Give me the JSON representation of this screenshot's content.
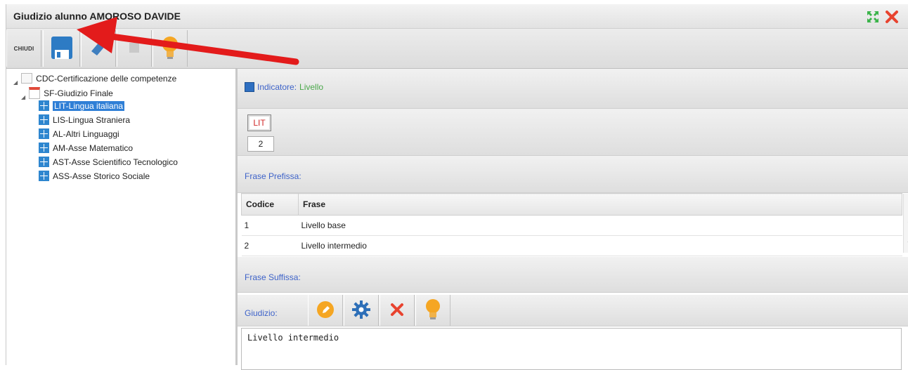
{
  "window": {
    "title": "Giudizio alunno AMOROSO DAVIDE"
  },
  "toolbar": {
    "close_label": "CHIUDI"
  },
  "tree": {
    "root": "CDC-Certificazione delle competenze",
    "child": "SF-Giudizio Finale",
    "items": [
      {
        "label": "LIT-Lingua italiana",
        "selected": true
      },
      {
        "label": "LIS-Lingua Straniera",
        "selected": false
      },
      {
        "label": "AL-Altri Linguaggi",
        "selected": false
      },
      {
        "label": "AM-Asse Matematico",
        "selected": false
      },
      {
        "label": "AST-Asse Scientifico Tecnologico",
        "selected": false
      },
      {
        "label": "ASS-Asse Storico Sociale",
        "selected": false
      }
    ]
  },
  "indicator": {
    "label": "Indicatore:",
    "value": "Livello"
  },
  "code": {
    "button": "LIT",
    "value": "2"
  },
  "prefix": {
    "label": "Frase Prefissa:"
  },
  "table": {
    "headers": [
      "Codice",
      "Frase"
    ],
    "rows": [
      [
        "1",
        "Livello base"
      ],
      [
        "2",
        "Livello intermedio"
      ]
    ]
  },
  "suffix": {
    "label": "Frase Suffissa:"
  },
  "giudizio": {
    "label": "Giudizio:",
    "text": "Livello intermedio"
  },
  "colors": {
    "accent": "#2f7fd6",
    "label_blue": "#3e63c9",
    "label_green": "#4ba84b",
    "arrow_red": "#e31b1b"
  }
}
